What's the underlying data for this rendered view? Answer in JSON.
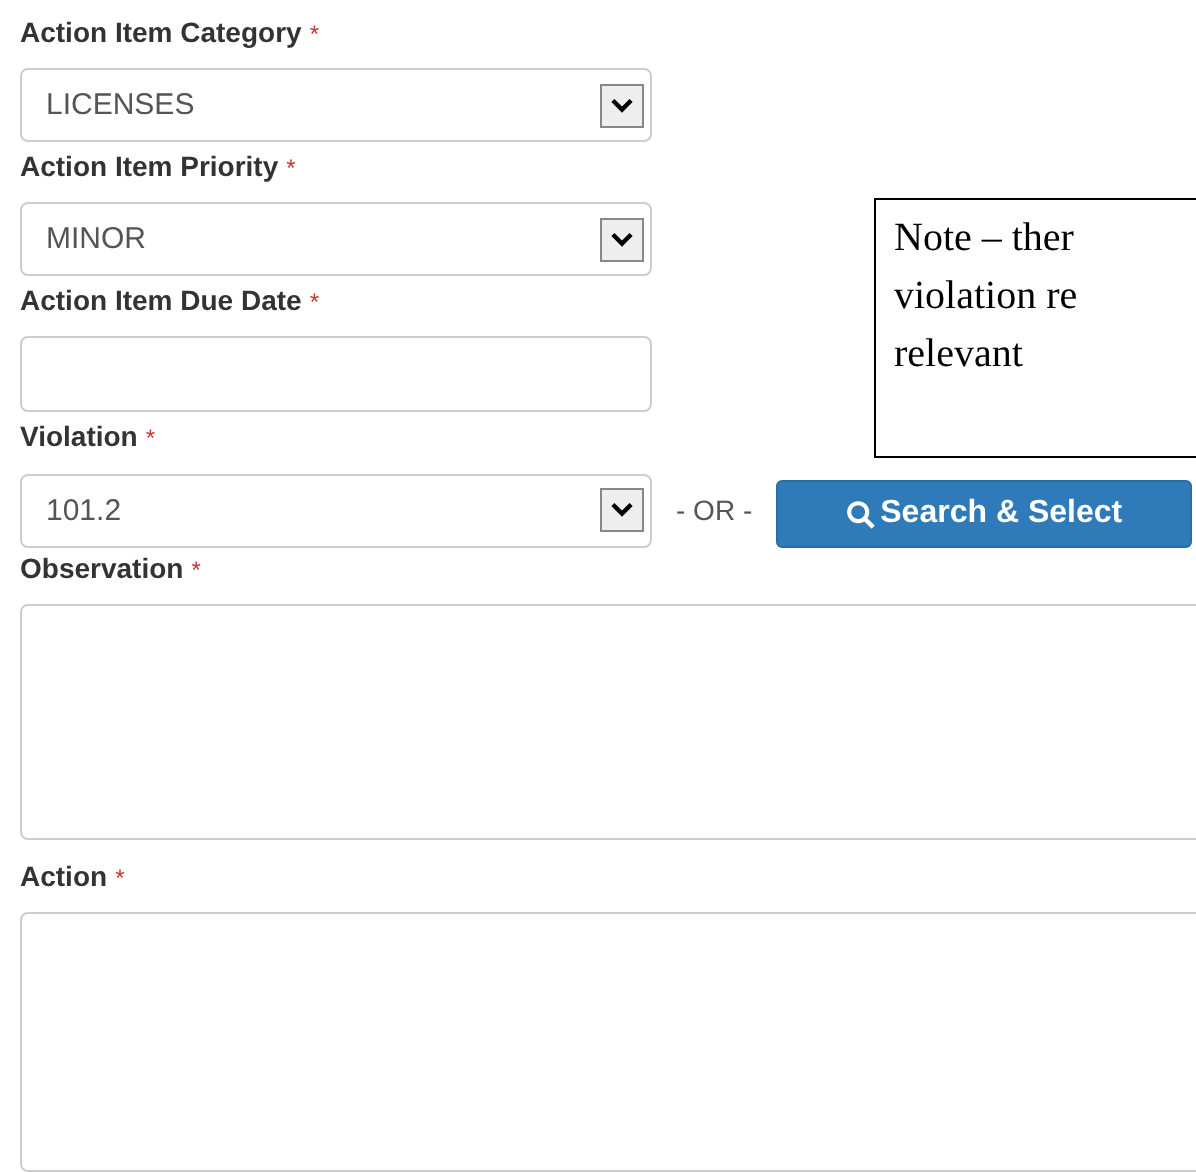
{
  "fields": [
    {
      "kind": "select",
      "label": "Action Item Category",
      "required": true,
      "value": "LICENSES"
    },
    {
      "kind": "select",
      "label": "Action Item Priority",
      "required": true,
      "value": "MINOR"
    },
    {
      "kind": "text",
      "label": "Action Item Due Date",
      "required": true
    },
    {
      "kind": "violation",
      "label": "Violation",
      "required": true,
      "value": "101.2",
      "separator": "- OR -",
      "button": "Search & Select"
    },
    {
      "kind": "textarea",
      "label": "Observation",
      "required": true
    },
    {
      "kind": "textarea",
      "label": "Action",
      "required": true
    }
  ],
  "required_mark": "*",
  "note": {
    "lines": [
      "Note – ther",
      "violation re",
      "relevant"
    ]
  }
}
